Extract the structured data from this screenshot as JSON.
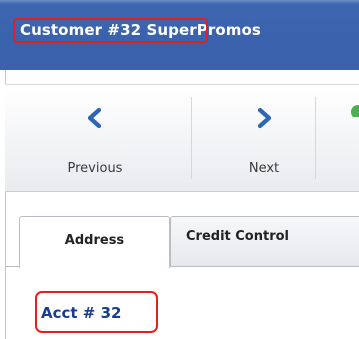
{
  "window": {
    "title": "Customer  #32  SuperPromos"
  },
  "toolbar": {
    "previous_label": "Previous",
    "next_label": "Next",
    "previous_icon": "chevron-left-icon",
    "next_icon": "chevron-right-icon",
    "accent_color": "#2f66b3"
  },
  "tabs": [
    {
      "label": "Address",
      "active": true
    },
    {
      "label": "Credit Control",
      "active": false
    }
  ],
  "account": {
    "label": "Acct #  32"
  },
  "colors": {
    "titlebar": "#3b63ad",
    "highlight": "#e0221b",
    "acct_text": "#1a3c8e"
  }
}
